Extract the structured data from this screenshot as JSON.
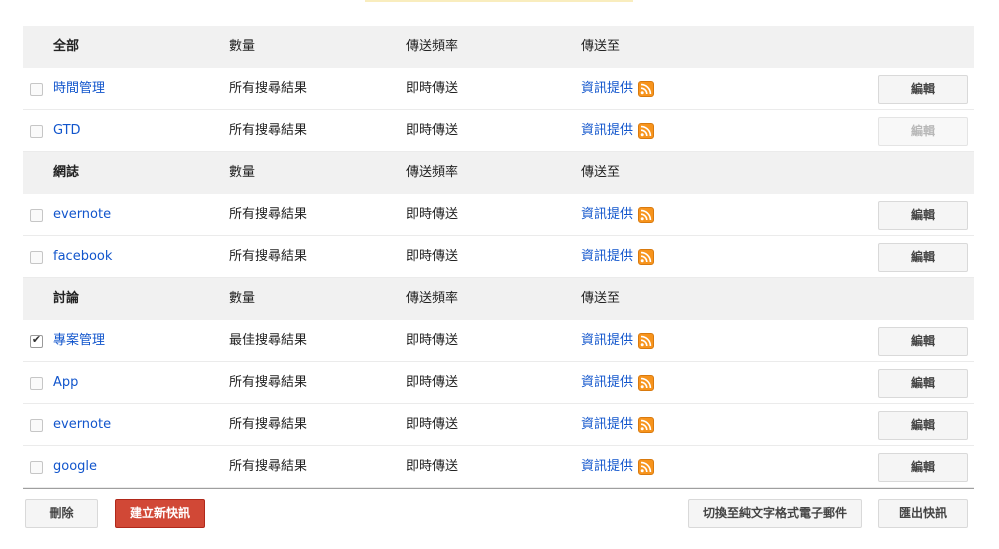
{
  "columns": {
    "quantity": "數量",
    "frequency": "傳送頻率",
    "deliver_to": "傳送至"
  },
  "groups": [
    {
      "title": "全部",
      "items": [
        {
          "name": "時間管理",
          "quantity": "所有搜尋結果",
          "frequency": "即時傳送",
          "destination": "資訊提供",
          "checked": false,
          "edit_label": "編輯",
          "edit_enabled": true
        },
        {
          "name": "GTD",
          "quantity": "所有搜尋結果",
          "frequency": "即時傳送",
          "destination": "資訊提供",
          "checked": false,
          "edit_label": "編輯",
          "edit_enabled": false
        }
      ]
    },
    {
      "title": "網誌",
      "items": [
        {
          "name": "evernote",
          "quantity": "所有搜尋結果",
          "frequency": "即時傳送",
          "destination": "資訊提供",
          "checked": false,
          "edit_label": "編輯",
          "edit_enabled": true
        },
        {
          "name": "facebook",
          "quantity": "所有搜尋結果",
          "frequency": "即時傳送",
          "destination": "資訊提供",
          "checked": false,
          "edit_label": "編輯",
          "edit_enabled": true
        }
      ]
    },
    {
      "title": "討論",
      "items": [
        {
          "name": "專案管理",
          "quantity": "最佳搜尋結果",
          "frequency": "即時傳送",
          "destination": "資訊提供",
          "checked": true,
          "edit_label": "編輯",
          "edit_enabled": true
        },
        {
          "name": "App",
          "quantity": "所有搜尋結果",
          "frequency": "即時傳送",
          "destination": "資訊提供",
          "checked": false,
          "edit_label": "編輯",
          "edit_enabled": true
        },
        {
          "name": "evernote",
          "quantity": "所有搜尋結果",
          "frequency": "即時傳送",
          "destination": "資訊提供",
          "checked": false,
          "edit_label": "編輯",
          "edit_enabled": true
        },
        {
          "name": "google",
          "quantity": "所有搜尋結果",
          "frequency": "即時傳送",
          "destination": "資訊提供",
          "checked": false,
          "edit_label": "編輯",
          "edit_enabled": true
        }
      ]
    }
  ],
  "footer": {
    "delete_label": "刪除",
    "create_label": "建立新快訊",
    "switch_label": "切換至純文字格式電子郵件",
    "export_label": "匯出快訊"
  },
  "colors": {
    "link": "#1155cc",
    "create_button": "#d14836",
    "rss": "#f7941d",
    "header_bg": "#f1f1f1"
  },
  "icons": {
    "feed": "rss-icon",
    "checked": "checkmark-icon"
  }
}
